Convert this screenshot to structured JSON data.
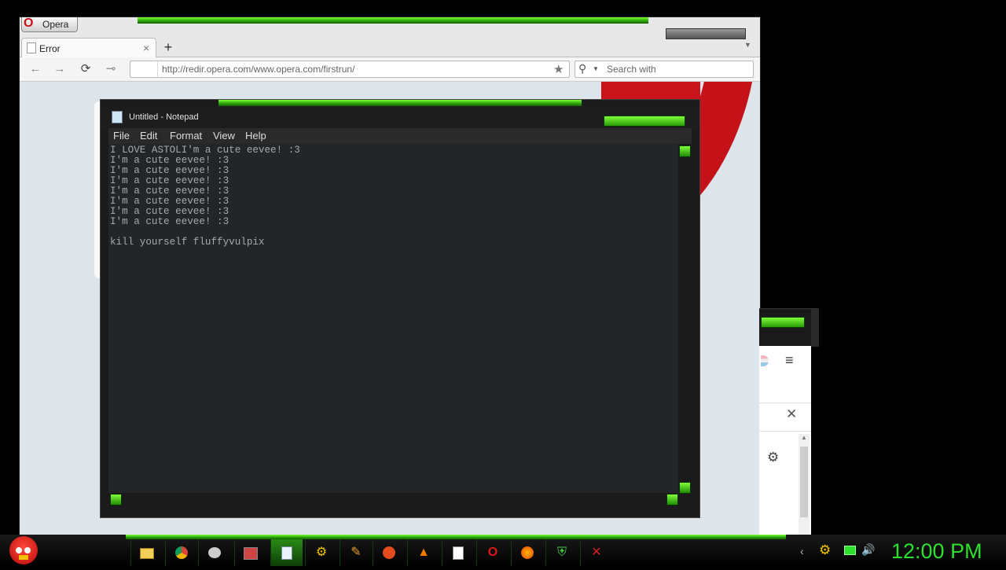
{
  "opera": {
    "menu_label": "Opera",
    "tab_title": "Error",
    "tab_close": "×",
    "new_tab": "+",
    "url": "http://redir.opera.com/www.opera.com/firstrun/",
    "search_placeholder": "Search with",
    "nav": {
      "back": "←",
      "forward": "→",
      "reload": "⟳",
      "key": "⊸",
      "bookmark": "★",
      "search_icon": "⚲",
      "tab_menu": "▼"
    }
  },
  "notepad": {
    "title": "Untitled - Notepad",
    "menu": [
      "File",
      "Edit",
      "Format",
      "View",
      "Help"
    ],
    "content": "I LOVE ASTOLI'm a cute eevee! :3\nI'm a cute eevee! :3\nI'm a cute eevee! :3\nI'm a cute eevee! :3\nI'm a cute eevee! :3\nI'm a cute eevee! :3\nI'm a cute eevee! :3\nI'm a cute eevee! :3\n\nkill yourself fluffyvulpix"
  },
  "right_window": {
    "menu_icon": "≡",
    "close_icon": "✕",
    "settings_icon": "⚙",
    "scroll_up": "▲"
  },
  "taskbar": {
    "apps": [
      "folder-icon",
      "chrome-icon",
      "paint-icon",
      "media-icon",
      "notepad-icon",
      "settings-icon",
      "brush-icon",
      "flash-icon",
      "vlc-icon",
      "cards-icon",
      "opera-icon",
      "firefox-icon",
      "shield-icon",
      "game-icon"
    ],
    "tray": [
      "arrow-icon",
      "gear-icon",
      "battery-icon",
      "volume-icon"
    ],
    "clock": "12:00 PM"
  },
  "colors": {
    "accent_green": "#2ee02e",
    "opera_red": "#cc0f16"
  }
}
